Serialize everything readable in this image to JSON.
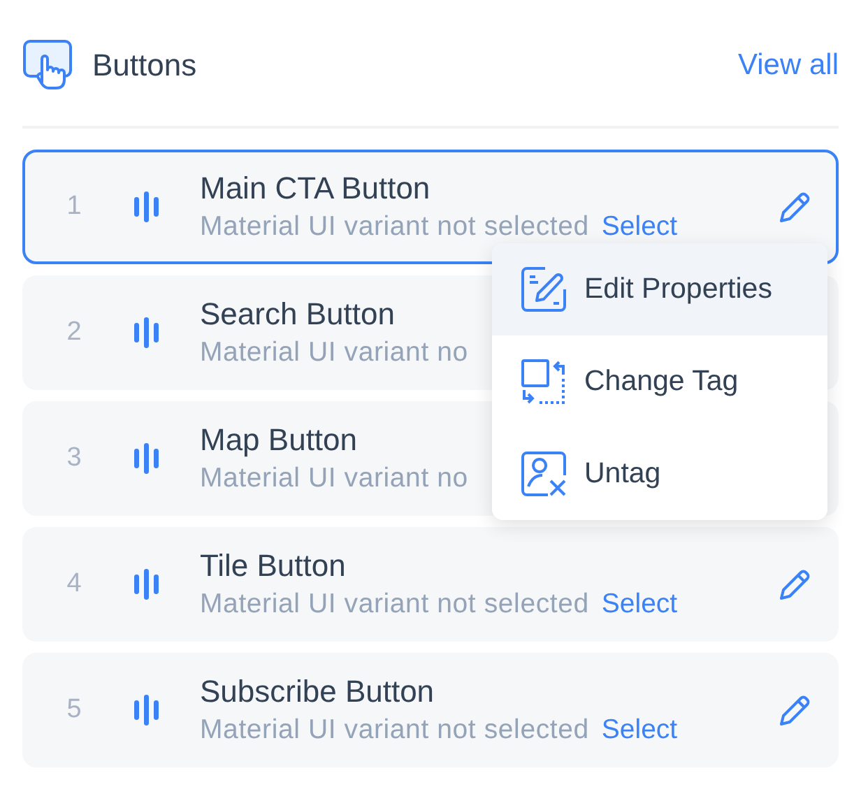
{
  "header": {
    "title": "Buttons",
    "link": "View all"
  },
  "rows": [
    {
      "number": "1",
      "title": "Main CTA Button",
      "subtitle": "Material UI variant not selected",
      "select": "Select",
      "edit_icon": true,
      "selected": true
    },
    {
      "number": "2",
      "title": "Search Button",
      "subtitle": "Material UI variant no",
      "edit_icon": false,
      "selected": false
    },
    {
      "number": "3",
      "title": "Map Button",
      "subtitle": "Material UI variant no",
      "edit_icon": false,
      "selected": false
    },
    {
      "number": "4",
      "title": "Tile Button",
      "subtitle": "Material UI variant not selected",
      "select": "Select",
      "edit_icon": true,
      "selected": false
    },
    {
      "number": "5",
      "title": "Subscribe Button",
      "subtitle": "Material UI variant not selected",
      "select": "Select",
      "edit_icon": true,
      "selected": false
    }
  ],
  "menu": {
    "items": [
      {
        "kind": "edit",
        "label": "Edit Properties",
        "selected": true
      },
      {
        "kind": "change",
        "label": "Change Tag",
        "selected": false
      },
      {
        "kind": "untag",
        "label": "Untag",
        "selected": false
      }
    ]
  }
}
